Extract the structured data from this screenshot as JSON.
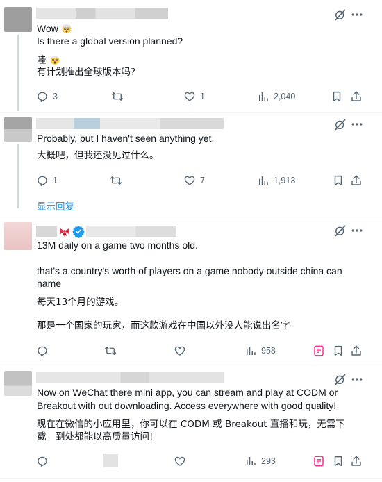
{
  "tweets": [
    {
      "lines": [
        "Wow",
        "Is there a global version planned?",
        "",
        "哇",
        "有计划推出全球版本吗?"
      ],
      "stats": {
        "replies": "3",
        "retweets": "",
        "likes": "1",
        "views": "2,040"
      }
    },
    {
      "lines": [
        "Probably, but I haven't seen anything yet.",
        "大概吧，但我还没见过什么。"
      ],
      "stats": {
        "replies": "1",
        "retweets": "",
        "likes": "7",
        "views": "1,913"
      }
    },
    {
      "lines": [
        "13M daily on a game two months old.",
        "that's a country's worth of players on a game nobody outside china can",
        "name",
        "每天13个月的游戏。",
        "那是一个国家的玩家，而这款游戏在中国以外没人能说出名字"
      ],
      "stats": {
        "replies": "",
        "retweets": "",
        "likes": "",
        "views": "958"
      }
    },
    {
      "lines": [
        "Now on WeChat there mini app, you can stream and play at CODM or",
        "Breakout with out downloading. Access everywhere with good quality!",
        "现在在微信的小应用里，你可以在 CODM 或 Breakout 直播和玩，无需下",
        "载。到处都能以高质量访问!"
      ],
      "stats": {
        "replies": "",
        "retweets": "",
        "likes": "",
        "views": "293"
      }
    }
  ],
  "show_replies": "显示回复",
  "colors": {
    "accent": "#1d9bf0",
    "muted": "#536471",
    "pink": "#f91880",
    "verified": "#1d9bf0"
  },
  "icons": [
    "reply-icon",
    "retweet-icon",
    "like-icon",
    "views-icon",
    "bookmark-icon",
    "share-icon",
    "grok-icon",
    "more-icon",
    "verified-icon",
    "bow-emoji-icon",
    "shocked-emoji-icon"
  ]
}
